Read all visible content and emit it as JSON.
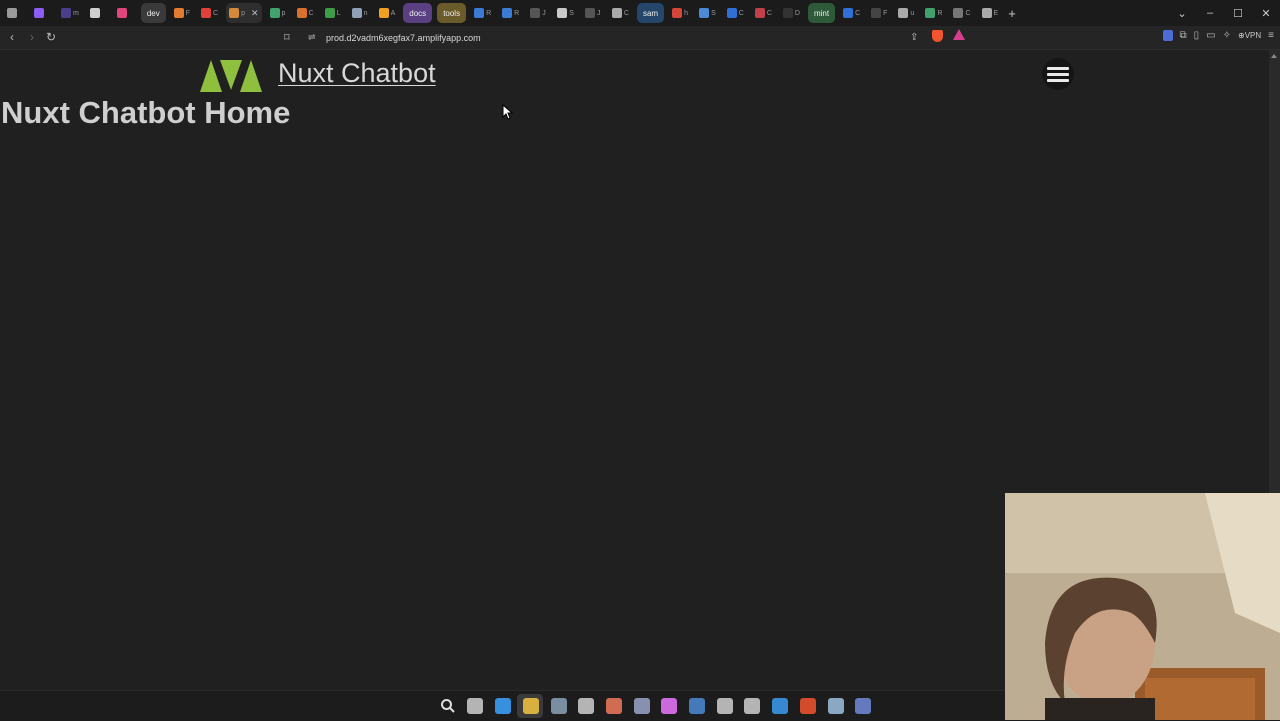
{
  "tabbar": {
    "tabs": [
      {
        "label": "",
        "color": "#9a9a9a"
      },
      {
        "label": "",
        "color": "#8b5cf6"
      },
      {
        "label": "m",
        "color": "#4a3f8a"
      },
      {
        "label": "",
        "color": "#cfcfcf"
      },
      {
        "label": "",
        "color": "#e0457b"
      },
      {
        "label": "dev",
        "group": true,
        "color": "#3a3a3a"
      },
      {
        "label": "F",
        "color": "#e07b2f"
      },
      {
        "label": "C",
        "color": "#e0403a"
      },
      {
        "label": "p",
        "color": "#d58a3a",
        "active": true
      },
      {
        "label": "p",
        "color": "#3fa36b"
      },
      {
        "label": "C",
        "color": "#d9702b"
      },
      {
        "label": "L",
        "color": "#3e9b46"
      },
      {
        "label": "n",
        "color": "#8fa0b8"
      },
      {
        "label": "A",
        "color": "#f0a020"
      },
      {
        "label": "docs",
        "group": true,
        "color": "#5a3f82"
      },
      {
        "label": "tools",
        "group": true,
        "color": "#6b5a2a"
      },
      {
        "label": "R",
        "color": "#3b7bd4"
      },
      {
        "label": "R",
        "color": "#3b7bd4"
      },
      {
        "label": "J",
        "color": "#555555"
      },
      {
        "label": "S",
        "color": "#c9c9c9"
      },
      {
        "label": "J",
        "color": "#555555"
      },
      {
        "label": "C",
        "color": "#aaaaaa"
      },
      {
        "label": "sam",
        "group": true,
        "color": "#23466a"
      },
      {
        "label": "h",
        "color": "#d44638"
      },
      {
        "label": "S",
        "color": "#4b8bd6"
      },
      {
        "label": "C",
        "color": "#2f6fd6"
      },
      {
        "label": "C",
        "color": "#c0404a"
      },
      {
        "label": "D",
        "color": "#333333"
      },
      {
        "label": "mint",
        "group": true,
        "color": "#2e5a3a"
      },
      {
        "label": "C",
        "color": "#2f6fd6"
      },
      {
        "label": "F",
        "color": "#444444"
      },
      {
        "label": "u",
        "color": "#aaaaaa"
      },
      {
        "label": "R",
        "color": "#3fa36b"
      },
      {
        "label": "C",
        "color": "#777777"
      },
      {
        "label": "E",
        "color": "#aaaaaa"
      }
    ],
    "new_tab": "+",
    "tab_close": "✕",
    "window_controls": {
      "list": "⌄",
      "minimize": "–",
      "maximize": "☐",
      "close": "✕"
    }
  },
  "toolbar": {
    "back": "‹",
    "forward": "›",
    "reload": "↻",
    "bookmark": "⌑",
    "site_settings": "⇌",
    "url": "prod.d2vadm6xegfax7.amplifyapp.com",
    "share": "⇪",
    "vpn_label": "⊕VPN",
    "menu": "≡"
  },
  "page": {
    "brand_title": "Nuxt Chatbot",
    "heading": "Nuxt Chatbot Home",
    "logo_color": "#8fbf3f"
  },
  "taskbar": {
    "icons": [
      {
        "name": "start-icon",
        "color": "#4cc2ff"
      },
      {
        "name": "search-icon",
        "color": "#dddddd"
      },
      {
        "name": "task-view-icon",
        "color": "#cfcfcf"
      },
      {
        "name": "copilot-icon",
        "color": "#3ba4ff"
      },
      {
        "name": "file-explorer-icon",
        "color": "#f5c542",
        "active": true
      },
      {
        "name": "settings-icon",
        "color": "#8aa3b8"
      },
      {
        "name": "store-icon",
        "color": "#cfcfcf"
      },
      {
        "name": "photos-icon",
        "color": "#f07a5a"
      },
      {
        "name": "photoshop-icon",
        "color": "#9aa4c8"
      },
      {
        "name": "premiere-icon",
        "color": "#ea77ff"
      },
      {
        "name": "shield-icon",
        "color": "#4b8bd6"
      },
      {
        "name": "chrome-icon",
        "color": "#cfcfcf"
      },
      {
        "name": "terminal-icon",
        "color": "#cfcfcf"
      },
      {
        "name": "vscode-icon",
        "color": "#3b9cf0"
      },
      {
        "name": "brave-icon",
        "color": "#f2542d"
      },
      {
        "name": "steam-icon",
        "color": "#9fc1e0"
      },
      {
        "name": "discord-icon",
        "color": "#7289da"
      }
    ]
  }
}
